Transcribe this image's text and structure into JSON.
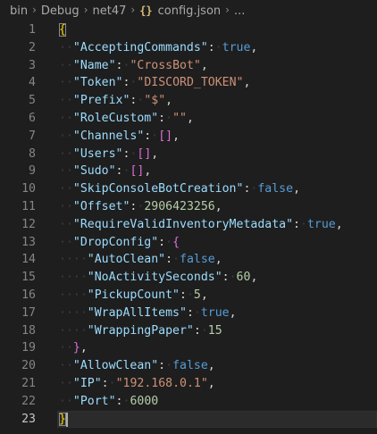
{
  "breadcrumb": {
    "items": [
      "bin",
      "Debug",
      "net47"
    ],
    "file_icon": "{}",
    "file_name": "config.json",
    "trailing": "..."
  },
  "editor": {
    "lines": [
      {
        "num": "1"
      },
      {
        "num": "2",
        "key": "\"AcceptingCommands\"",
        "value": "true",
        "kind": "bool",
        "tail": ","
      },
      {
        "num": "3",
        "key": "\"Name\"",
        "value": "\"CrossBot\"",
        "kind": "str",
        "tail": ","
      },
      {
        "num": "4",
        "key": "\"Token\"",
        "value": "\"DISCORD_TOKEN\"",
        "kind": "str",
        "tail": ","
      },
      {
        "num": "5",
        "key": "\"Prefix\"",
        "value": "\"$\"",
        "kind": "str",
        "tail": ","
      },
      {
        "num": "6",
        "key": "\"RoleCustom\"",
        "value": "\"\"",
        "kind": "str",
        "tail": ","
      },
      {
        "num": "7",
        "key": "\"Channels\"",
        "value": "[]",
        "kind": "arr",
        "tail": ","
      },
      {
        "num": "8",
        "key": "\"Users\"",
        "value": "[]",
        "kind": "arr",
        "tail": ","
      },
      {
        "num": "9",
        "key": "\"Sudo\"",
        "value": "[]",
        "kind": "arr",
        "tail": ","
      },
      {
        "num": "10",
        "key": "\"SkipConsoleBotCreation\"",
        "value": "false",
        "kind": "bool",
        "tail": ","
      },
      {
        "num": "11",
        "key": "\"Offset\"",
        "value": "2906423256",
        "kind": "num",
        "tail": ","
      },
      {
        "num": "12",
        "key": "\"RequireValidInventoryMetadata\"",
        "value": "true",
        "kind": "bool",
        "tail": ","
      },
      {
        "num": "13",
        "key": "\"DropConfig\"",
        "value": "{",
        "kind": "open",
        "tail": ""
      },
      {
        "num": "14",
        "key": "\"AutoClean\"",
        "value": "false",
        "kind": "bool",
        "tail": ","
      },
      {
        "num": "15",
        "key": "\"NoActivitySeconds\"",
        "value": "60",
        "kind": "num",
        "tail": ","
      },
      {
        "num": "16",
        "key": "\"PickupCount\"",
        "value": "5",
        "kind": "num",
        "tail": ","
      },
      {
        "num": "17",
        "key": "\"WrapAllItems\"",
        "value": "true",
        "kind": "bool",
        "tail": ","
      },
      {
        "num": "18",
        "key": "\"WrappingPaper\"",
        "value": "15",
        "kind": "num",
        "tail": ""
      },
      {
        "num": "19",
        "close": "}",
        "tail": ","
      },
      {
        "num": "20",
        "key": "\"AllowClean\"",
        "value": "false",
        "kind": "bool",
        "tail": ","
      },
      {
        "num": "21",
        "key": "\"IP\"",
        "value": "\"192.168.0.1\"",
        "kind": "str",
        "tail": ","
      },
      {
        "num": "22",
        "key": "\"Port\"",
        "value": "6000",
        "kind": "num",
        "tail": ""
      },
      {
        "num": "23"
      }
    ],
    "open_brace": "{",
    "close_brace": "}",
    "colon": ":",
    "current_line": "23"
  },
  "colors": {
    "background": "#1e1e1e",
    "key": "#9cdcfe",
    "string": "#ce9178",
    "number": "#b5cea8",
    "boolean": "#569cd6",
    "brace_level1": "#ffd700",
    "brace_level2": "#da70d6",
    "brace_level3": "#179fff"
  }
}
